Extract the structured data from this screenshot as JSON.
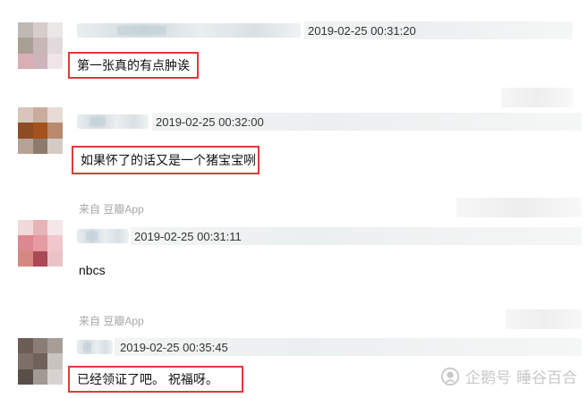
{
  "comments": [
    {
      "timestamp": "2019-02-25 00:31:20",
      "text": "第一张真的有点肿诶",
      "avatar_colors": [
        "#bfb9b5",
        "#d7cdca",
        "#eae7e6",
        "#a9a095",
        "#c7b7b7",
        "#e2d9dc",
        "#d9aeb5",
        "#ceb3bb",
        "#efe4e8"
      ]
    },
    {
      "timestamp": "2019-02-25 00:32:00",
      "text": "如果怀了的话又是一个猪宝宝咧",
      "avatar_colors": [
        "#d8c6bd",
        "#c8ad9c",
        "#e7dbd3",
        "#8e4c24",
        "#a4521b",
        "#b8896d",
        "#b6a294",
        "#8d7a6c",
        "#d6cbc3"
      ]
    },
    {
      "source": "来自 豆瓣App",
      "timestamp": "2019-02-25 00:31:11",
      "text": "nbcs",
      "avatar_colors": [
        "#f1d9dc",
        "#e7b2b8",
        "#f5e6e8",
        "#dc8890",
        "#e69aa1",
        "#f0c7cc",
        "#d5887f",
        "#a94a55",
        "#e9c3c6"
      ]
    },
    {
      "source": "来自 豆瓣App",
      "timestamp": "2019-02-25 00:35:45",
      "text": "已经领证了吧。 祝福呀。",
      "avatar_colors": [
        "#6b5e57",
        "#8a7d75",
        "#a89e98",
        "#7c6f67",
        "#6e625b",
        "#c9c3bf",
        "#5a4e48",
        "#a09994",
        "#d8d3d0"
      ]
    }
  ],
  "watermark": {
    "brand": "企鹅号",
    "author": "睡谷百合",
    "color": "#c8c8c8"
  },
  "accent": {
    "highlight_border": "#e03a3a"
  }
}
